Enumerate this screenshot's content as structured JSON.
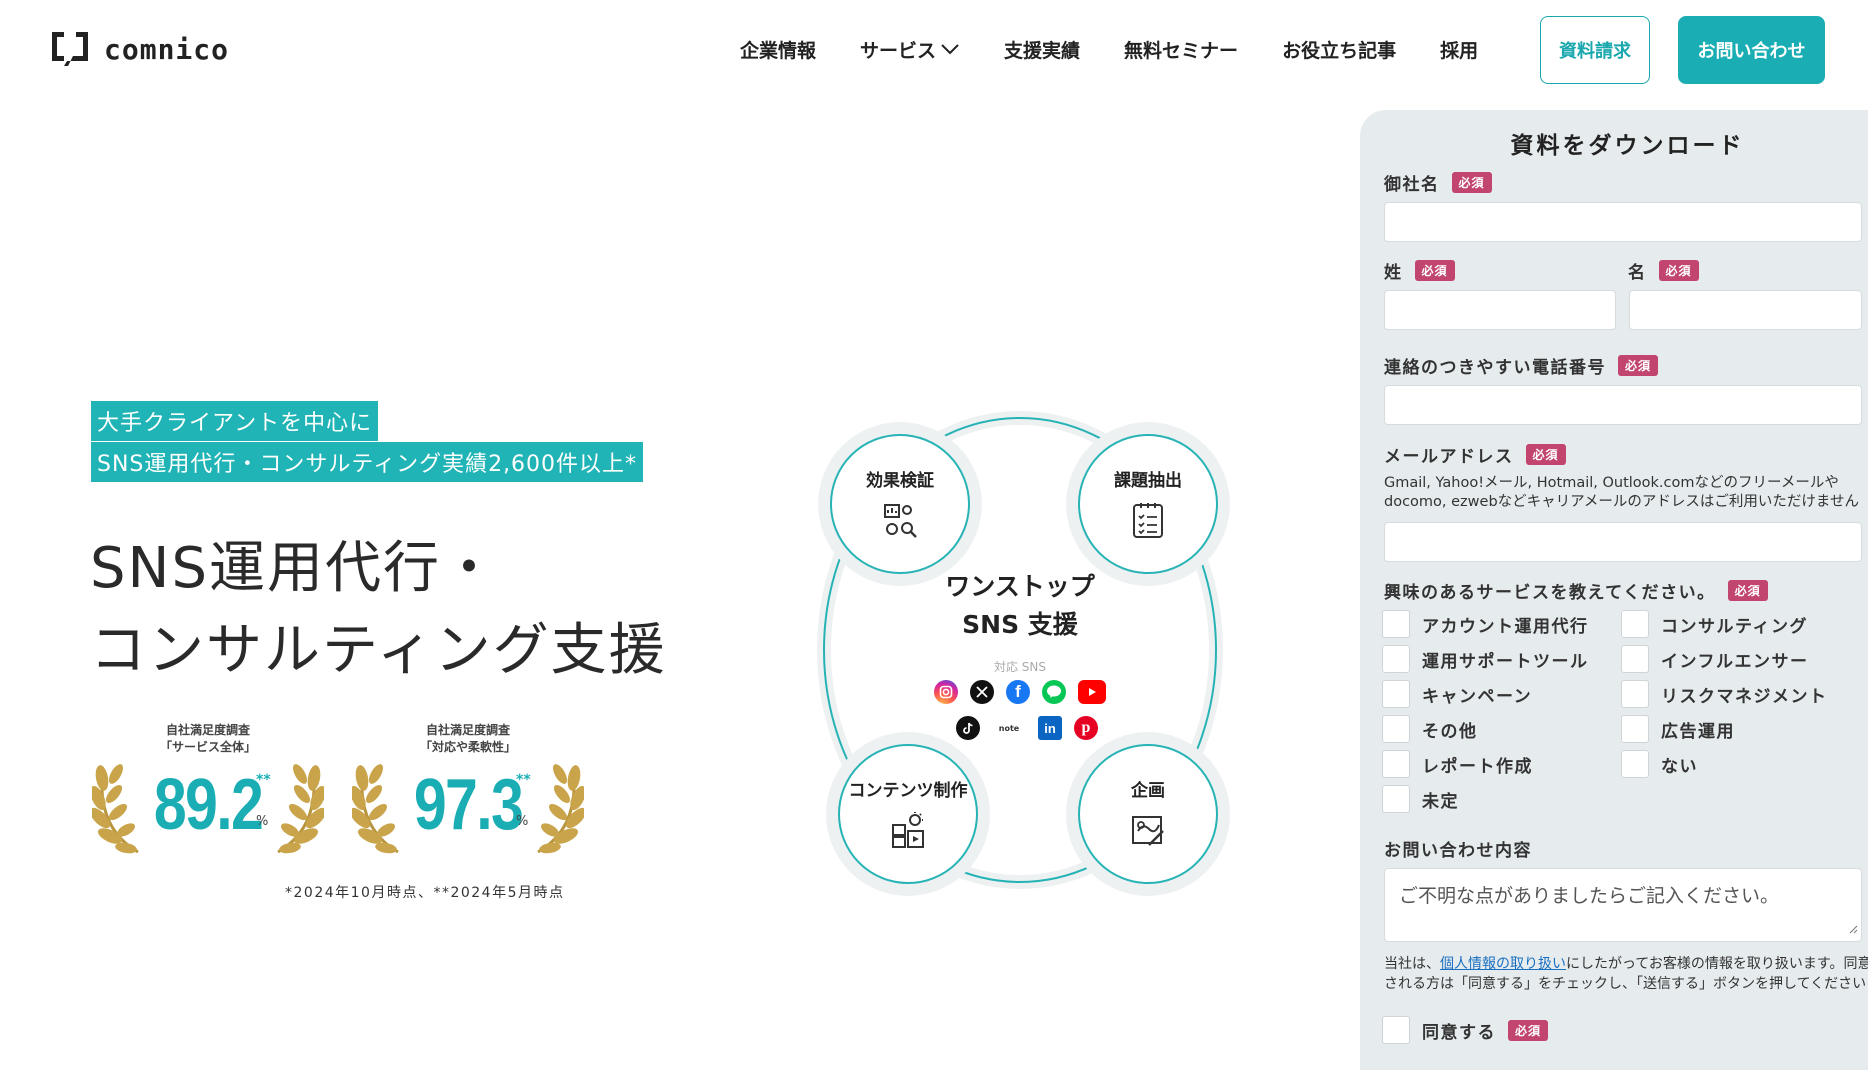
{
  "header": {
    "logo_text": "comnico",
    "nav": [
      {
        "label": "企業情報"
      },
      {
        "label": "サービス",
        "has_dropdown": true
      },
      {
        "label": "支援実績"
      },
      {
        "label": "無料セミナー"
      },
      {
        "label": "お役立ち記事"
      },
      {
        "label": "採用"
      }
    ],
    "doc_button": "資料請求",
    "contact_button": "お問い合わせ"
  },
  "hero": {
    "tag_line1": "大手クライアントを中心に",
    "tag_line2": "SNS運用代行・コンサルティング実績2,600件以上*",
    "title_line1": "SNS運用代行・",
    "title_line2": "コンサルティング支援",
    "badges": [
      {
        "caption1": "自社満足度調査",
        "caption2": "「サービス全体」",
        "value": "89.2",
        "asterisks": "**",
        "unit": "%"
      },
      {
        "caption1": "自社満足度調査",
        "caption2": "「対応や柔軟性」",
        "value": "97.3",
        "asterisks": "**",
        "unit": "%"
      }
    ],
    "footnote": "*2024年10月時点、**2024年5月時点"
  },
  "diagram": {
    "center_title1": "ワンストップ",
    "center_title2": "SNS 支援",
    "center_sub": "対応 SNS",
    "nodes": {
      "top_left": "効果検証",
      "top_right": "課題抽出",
      "bottom_left": "コンテンツ制作",
      "bottom_right": "企画"
    },
    "sns_icons_row1": [
      "instagram-icon",
      "x-icon",
      "facebook-icon",
      "line-icon",
      "youtube-icon"
    ],
    "sns_icons_row2": [
      "tiktok-icon",
      "note-icon",
      "linkedin-icon",
      "pinterest-icon"
    ],
    "note_label": "note",
    "accent_color": "#27b3b5"
  },
  "form": {
    "title": "資料をダウンロード",
    "required_label": "必須",
    "company_label": "御社名",
    "last_name_label": "姓",
    "first_name_label": "名",
    "phone_label": "連絡のつきやすい電話番号",
    "email_label": "メールアドレス",
    "email_hint": "Gmail, Yahoo!メール, Hotmail, Outlook.comなどのフリーメールやdocomo, ezwebなどキャリアメールのアドレスはご利用いただけません",
    "services_label": "興味のあるサービスを教えてください。",
    "services_left": [
      "アカウント運用代行",
      "運用サポートツール",
      "キャンペーン",
      "その他",
      "レポート作成",
      "未定"
    ],
    "services_right": [
      "コンサルティング",
      "インフルエンサー",
      "リスクマネジメント",
      "広告運用",
      "ない"
    ],
    "inquiry_label": "お問い合わせ内容",
    "inquiry_placeholder": "ご不明な点がありましたらご記入ください。",
    "privacy_prefix": "当社は、",
    "privacy_link": "個人情報の取り扱い",
    "privacy_suffix": "にしたがってお客様の情報を取り扱います。同意",
    "privacy_line2": "される方は「同意する」をチェックし、「送信する」ボタンを押してください",
    "agree_label": "同意する"
  },
  "colors": {
    "accent": "#1aaeb4",
    "required": "#c2456f",
    "panel": "#e6ecee"
  }
}
